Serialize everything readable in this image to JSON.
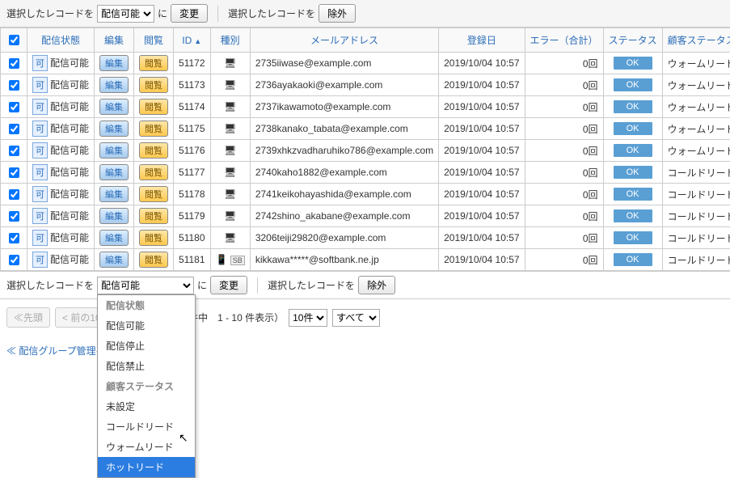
{
  "toolbar": {
    "label_prefix": "選択したレコードを",
    "ni": "に",
    "change": "変更",
    "label_exclude": "選択したレコードを",
    "exclude": "除外",
    "select_value": "配信可能"
  },
  "headers": [
    "配信状態",
    "編集",
    "閲覧",
    "ID",
    "種別",
    "メールアドレス",
    "登録日",
    "エラー（合計）",
    "ステータス",
    "顧客ステータス"
  ],
  "rows": [
    {
      "chk": true,
      "state": "配信可能",
      "id": "51172",
      "kind": "pc",
      "email": "2735iiwase@example.com",
      "date": "2019/10/04 10:57",
      "err": "0回",
      "cs": "ウォームリード"
    },
    {
      "chk": true,
      "state": "配信可能",
      "id": "51173",
      "kind": "pc",
      "email": "2736ayakaoki@example.com",
      "date": "2019/10/04 10:57",
      "err": "0回",
      "cs": "ウォームリード"
    },
    {
      "chk": true,
      "state": "配信可能",
      "id": "51174",
      "kind": "pc",
      "email": "2737ikawamoto@example.com",
      "date": "2019/10/04 10:57",
      "err": "0回",
      "cs": "ウォームリード"
    },
    {
      "chk": true,
      "state": "配信可能",
      "id": "51175",
      "kind": "pc",
      "email": "2738kanako_tabata@example.com",
      "date": "2019/10/04 10:57",
      "err": "0回",
      "cs": "ウォームリード"
    },
    {
      "chk": true,
      "state": "配信可能",
      "id": "51176",
      "kind": "pc",
      "email": "2739xhkzvadharuhiko786@example.com",
      "date": "2019/10/04 10:57",
      "err": "0回",
      "cs": "ウォームリード"
    },
    {
      "chk": true,
      "state": "配信可能",
      "id": "51177",
      "kind": "pc",
      "email": "2740kaho1882@example.com",
      "date": "2019/10/04 10:57",
      "err": "0回",
      "cs": "コールドリード"
    },
    {
      "chk": true,
      "state": "配信可能",
      "id": "51178",
      "kind": "pc",
      "email": "2741keikohayashida@example.com",
      "date": "2019/10/04 10:57",
      "err": "0回",
      "cs": "コールドリード"
    },
    {
      "chk": true,
      "state": "配信可能",
      "id": "51179",
      "kind": "pc",
      "email": "2742shino_akabane@example.com",
      "date": "2019/10/04 10:57",
      "err": "0回",
      "cs": "コールドリード"
    },
    {
      "chk": true,
      "state": "配信可能",
      "id": "51180",
      "kind": "pc",
      "email": "3206teiji29820@example.com",
      "date": "2019/10/04 10:57",
      "err": "0回",
      "cs": "コールドリード"
    },
    {
      "chk": true,
      "state": "配信可能",
      "id": "51181",
      "kind": "mb",
      "email": "kikkawa*****@softbank.ne.jp",
      "date": "2019/10/04 10:57",
      "err": "0回",
      "cs": "コールドリード",
      "sb": true
    }
  ],
  "buttons": {
    "edit": "編集",
    "view": "閲覧",
    "ok": "OK"
  },
  "pager": {
    "first": "≪先頭",
    "prev": "< 前の10",
    "info": "1,171 件中　1 - 10 件表示）",
    "per": "10件",
    "all": "すべて"
  },
  "backlink": "≪ 配信グループ管理へ",
  "dropdown": {
    "h1": "配信状態",
    "o1": "配信可能",
    "o2": "配信停止",
    "o3": "配信禁止",
    "h2": "顧客ステータス",
    "o4": "未設定",
    "o5": "コールドリード",
    "o6": "ウォームリード",
    "o7": "ホットリード"
  }
}
